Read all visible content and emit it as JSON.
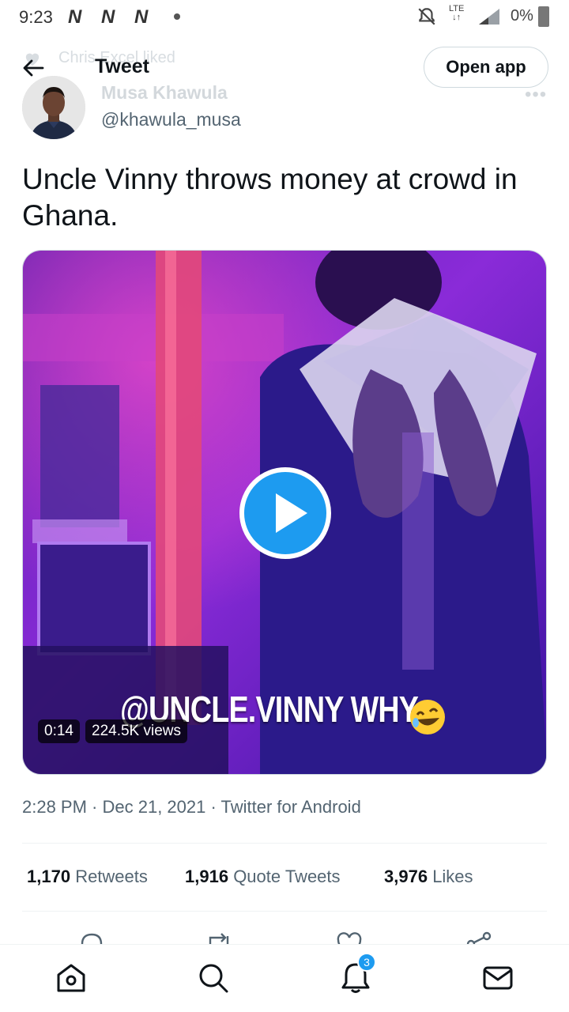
{
  "status_bar": {
    "time": "9:23",
    "app_icons": [
      "N",
      "N",
      "N"
    ],
    "network": "LTE",
    "battery": "0%"
  },
  "header": {
    "title": "Tweet",
    "open_app_label": "Open app"
  },
  "social_context": {
    "text": "Chris Excel liked"
  },
  "author": {
    "name": "Musa Khawula",
    "handle": "@khawula_musa"
  },
  "tweet": {
    "text": "Uncle Vinny throws money at crowd in Ghana.",
    "media": {
      "caption_overlay": "@UNCLE.VINNY WHY",
      "caption_emoji": "rolling-on-floor-laughing",
      "duration": "0:14",
      "views": "224.5K views"
    },
    "meta": "2:28 PM · Dec 21, 2021 · Twitter for Android"
  },
  "stats": [
    {
      "count": "1,170",
      "label": "Retweets"
    },
    {
      "count": "1,916",
      "label": "Quote Tweets"
    },
    {
      "count": "3,976",
      "label": "Likes"
    }
  ],
  "actions": [
    "reply-icon",
    "retweet-icon",
    "like-icon",
    "share-icon"
  ],
  "bottom_nav": {
    "items": [
      "home-icon",
      "search-icon",
      "notifications-icon",
      "messages-icon"
    ],
    "notifications_badge": "3"
  },
  "colors": {
    "accent": "#1d9bf0",
    "text_primary": "#0f1419",
    "text_secondary": "#536471",
    "border": "#cfd9de"
  }
}
